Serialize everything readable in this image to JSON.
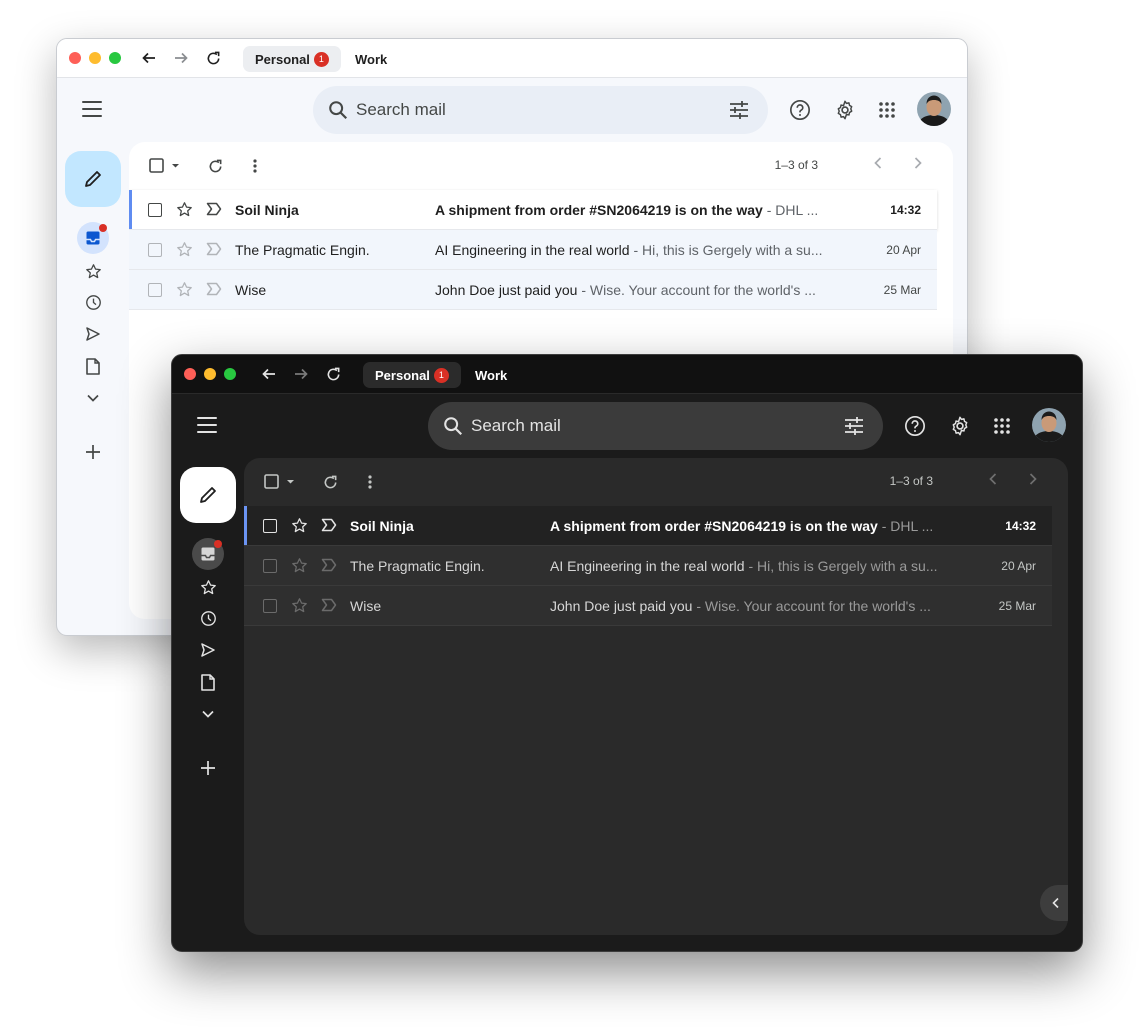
{
  "colors": {
    "accent": "#5f8cf1",
    "badge": "#d93025",
    "compose_light": "#c2e7ff"
  },
  "windows": [
    {
      "theme": "light",
      "tabs": [
        {
          "label": "Personal",
          "badge": "1"
        },
        {
          "label": "Work"
        }
      ],
      "search": {
        "placeholder": "Search mail"
      },
      "pager": "1–3 of 3",
      "emails": [
        {
          "sender": "Soil Ninja",
          "subject": "A shipment from order #SN2064219 is on the way",
          "snippet": " - DHL ...",
          "date": "14:32",
          "unread": true
        },
        {
          "sender": "The Pragmatic Engin.",
          "subject": "AI Engineering in the real world",
          "snippet": " - Hi, this is Gergely with a su...",
          "date": "20 Apr",
          "unread": false
        },
        {
          "sender": "Wise",
          "subject": "John Doe just paid you",
          "snippet": " - Wise. Your account for the world's ...",
          "date": "25 Mar",
          "unread": false
        }
      ]
    },
    {
      "theme": "dark",
      "tabs": [
        {
          "label": "Personal",
          "badge": "1"
        },
        {
          "label": "Work"
        }
      ],
      "search": {
        "placeholder": "Search mail"
      },
      "pager": "1–3 of 3",
      "emails": [
        {
          "sender": "Soil Ninja",
          "subject": "A shipment from order #SN2064219 is on the way",
          "snippet": " - DHL ...",
          "date": "14:32",
          "unread": true
        },
        {
          "sender": "The Pragmatic Engin.",
          "subject": "AI Engineering in the real world",
          "snippet": " - Hi, this is Gergely with a su...",
          "date": "20 Apr",
          "unread": false
        },
        {
          "sender": "Wise",
          "subject": "John Doe just paid you",
          "snippet": " - Wise. Your account for the world's ...",
          "date": "25 Mar",
          "unread": false
        }
      ]
    }
  ]
}
